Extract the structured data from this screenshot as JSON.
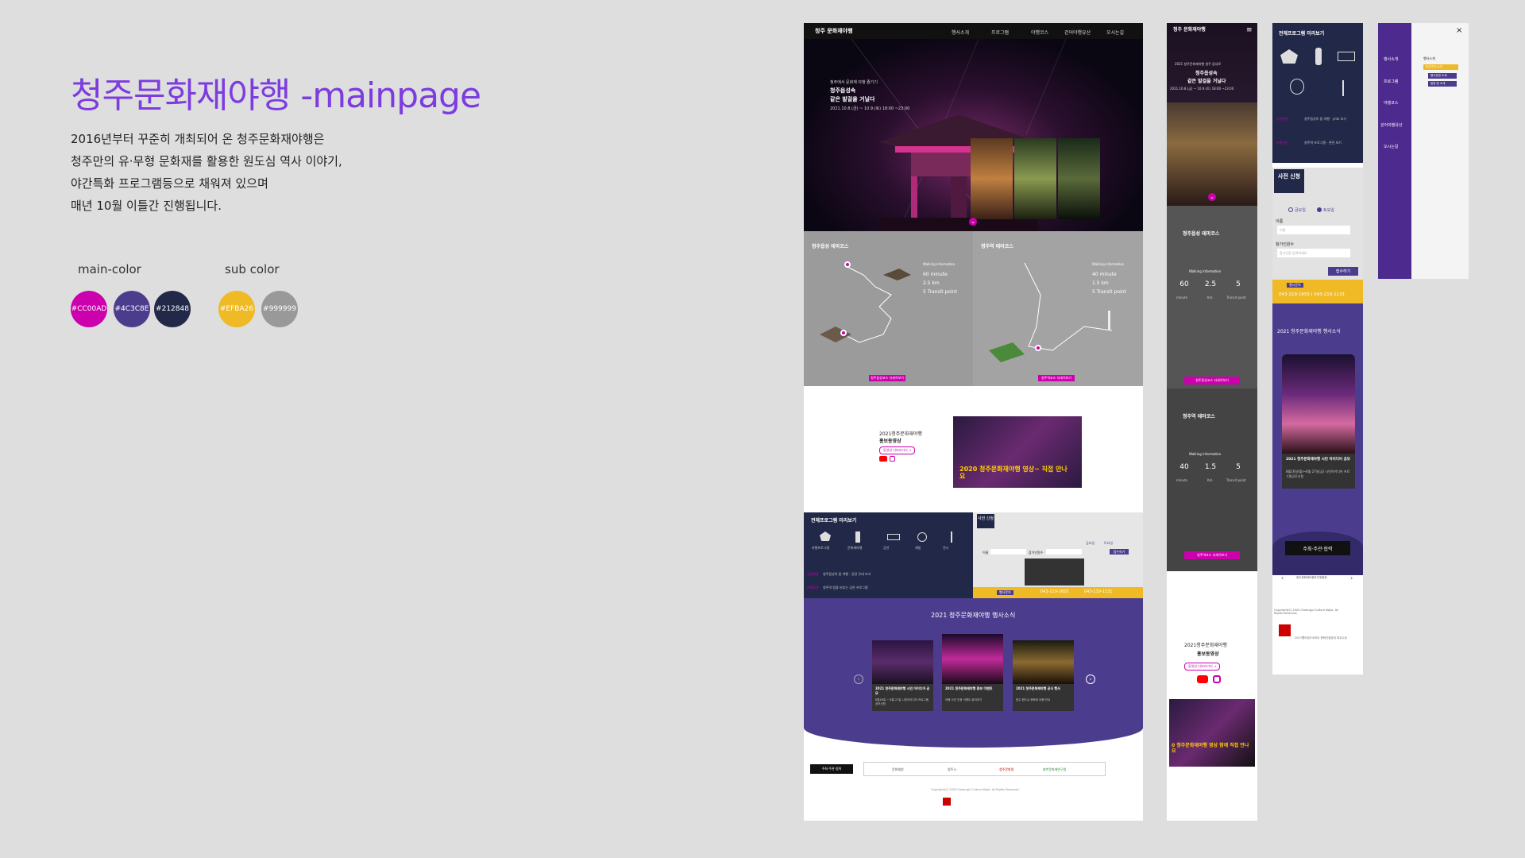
{
  "intro": {
    "title": "청주문화재야행 -mainpage",
    "lines": [
      "2016년부터 꾸준히 개최되어 온 청주문화재야행은",
      "청주만의 유·무형 문화재를 활용한 원도심 역사 이야기,",
      "야간특화 프로그램등으로 채워져 있으며",
      "매년 10월 이틀간 진행됩니다."
    ]
  },
  "palette": {
    "main_label": "main-color",
    "sub_label": "sub color",
    "main": [
      "#CC00AD",
      "#4C3C8E",
      "#212848"
    ],
    "sub": [
      "#EFBA26",
      "#999999"
    ]
  },
  "desktop": {
    "logo": "청주 문화재야행",
    "nav": [
      "행사소개",
      "프로그램",
      "야행코스",
      "걷어야행유산",
      "오시는길"
    ],
    "hero_small": "청주에서 문화재 야행 즐기기",
    "hero_title_1": "청주읍성속",
    "hero_title_2": "같은 발걸을 거닐다",
    "hero_date": "2021.10.8.(금) ~ 10.9.(토) 18:00 ~23:00",
    "course1_title": "청주읍성 테마코스",
    "course2_title": "청주역 테마코스",
    "walking_info": "Walking information",
    "course1_stats": [
      "60 minute",
      "2.5 km",
      "5 Transit point"
    ],
    "course2_stats": [
      "40 minute",
      "1.5 km",
      "5 Transit point"
    ],
    "course1_btn": "청주읍성코스 자세히보기",
    "course2_btn": "청주역코스 자세히보기",
    "promo_title_1": "2021청주문화재야행",
    "promo_title_2": "홍보동영상",
    "promo_link": "동영상 더보러가기 →",
    "video_caption": "2020 청주문화재야행 영상~ 직접 만나요",
    "program_title": "전체프로그램 미리보기",
    "program_items": [
      "야행프로그램",
      "문화재야행",
      "공연",
      "체험",
      "전시"
    ],
    "program_row1_tag": "공연체험",
    "program_row1_text": "청주읍성의 밤 야행 · 공연 무대 보기",
    "program_row2_tag": "야행공연",
    "program_row2_text": "청주역 밤을 비추는 공연 프로그램",
    "apply_label": "사전 신청",
    "radio_fri": "금요일",
    "radio_sat": "토요일",
    "name_label": "이름",
    "phone_label": "참가인원수",
    "apply_btn": "접수하기",
    "contact_label": "행사문의",
    "phone1": "043-219-1655",
    "phone2": "043-219-1131",
    "news_title": "2021 청주문화재야행 행사소식",
    "news_cards": [
      {
        "title": "2021 청주문화재야행 시민 아이디어 공모",
        "text": "8월16일 ~ 8월 27일 시민아이디어 프로그램 공모신청"
      },
      {
        "title": "2021 청주문화재야행 홍보 이벤트",
        "text": "야행 사진 인증 이벤트 참여하기"
      },
      {
        "title": "2021 청주문화재야행 공식 행사",
        "text": "청주 원도심 문화재 야행 안내"
      }
    ],
    "host_btn": "주최·주관·협력",
    "partners": [
      "문화재청",
      "청주시",
      "청주문화원",
      "충북문화재연구원"
    ],
    "copyright": "Copyright(C) 2020 Cheongju Culture Night. All Rights Reserved."
  },
  "mobile": {
    "logo": "청주 문화재야행",
    "hero_small": "2021 청주문화재야행 청주 읍내로",
    "hero_title_1": "청주읍성속",
    "hero_title_2": "같은 발걸을 거닐다",
    "hero_date": "2021.10.8.(금) ~ 10.9.(토) 18:00 ~23:00",
    "course1_title": "청주읍성 테마코스",
    "course2_title": "청주역 테마코스",
    "walking_info": "Walking information",
    "course1_vals": [
      "60",
      "2.5",
      "5"
    ],
    "course2_vals": [
      "40",
      "1.5",
      "5"
    ],
    "units": [
      "minute",
      "Km",
      "Transit point"
    ],
    "course1_btn": "청주읍성코스 자세히보기",
    "course2_btn": "청주역코스 자세히보기",
    "promo_title_1": "2021청주문화재야행",
    "promo_title_2": "홍보동영상",
    "promo_link": "동영상 더보러가기 →",
    "video_caption": "0 청주문화재야행 영상 함께 직접 만나요"
  },
  "mobile2": {
    "program_title": "전체프로그램 미리보기",
    "row1_tag": "공연체험",
    "row1_text": "청주읍성의 밤 야행 · ymk 보기",
    "row2_tag": "야행공연",
    "row2_text": "청주역 프로그램 · 관련 보기",
    "apply_label": "사전 신청",
    "radio_fri": "금요일",
    "radio_sat": "토요일",
    "name_label": "이름",
    "name_placeholder": "이름",
    "count_label": "참가인원수",
    "count_placeholder": "참가인원 입력하세요",
    "apply_btn": "접수하기",
    "contact_label": "행사문의",
    "phones": "043-219-1655 | 043-219-1131",
    "news_title": "2021 청주문화재야행 행사소식",
    "news_card_title": "2021 청주문화재야행 시민 아이디어 공모",
    "news_card_text": "8월16일(월)~8월 27일(금) 시민아이디어 프로그램공모신청",
    "host_btn": "주최·주관·협력",
    "partner": "청주문화재야행추진위원회",
    "copyright": "Copyright(C) 2020 Cheongju Culture Night. All Rights Reserved.",
    "award": "2017웹어워드코리아 문화관광분야 최우수상"
  },
  "menu": {
    "items": [
      "행사소개",
      "프로그램",
      "야행코스",
      "걷어야행유산",
      "오시는길"
    ],
    "sub_items": [
      "행사소개",
      "비전가치 소개",
      "행사운영 소개",
      "일정 및 소개"
    ]
  }
}
